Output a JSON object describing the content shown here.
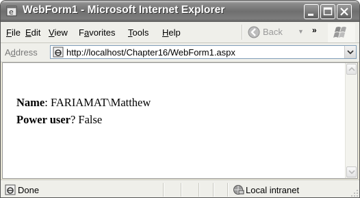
{
  "window": {
    "title": "WebForm1 - Microsoft Internet Explorer"
  },
  "menu": {
    "items": [
      {
        "key": "F",
        "rest": "ile"
      },
      {
        "key": "E",
        "rest": "dit"
      },
      {
        "key": "V",
        "rest": "iew"
      },
      {
        "pre": "F",
        "key": "a",
        "rest": "vorites"
      },
      {
        "key": "T",
        "rest": "ools"
      },
      {
        "key": "H",
        "rest": "elp"
      }
    ],
    "back_label": "Back",
    "overflow_glyph": "»"
  },
  "address": {
    "label_pre": "A",
    "label_key": "d",
    "label_rest": "dress",
    "url": "http://localhost/Chapter16/WebForm1.aspx"
  },
  "content": {
    "line1_label": "Name",
    "line1_value": ": FARIAMAT\\Matthew",
    "line2_label": "Power user",
    "line2_value": "? False"
  },
  "status": {
    "text": "Done",
    "zone": "Local intranet"
  }
}
